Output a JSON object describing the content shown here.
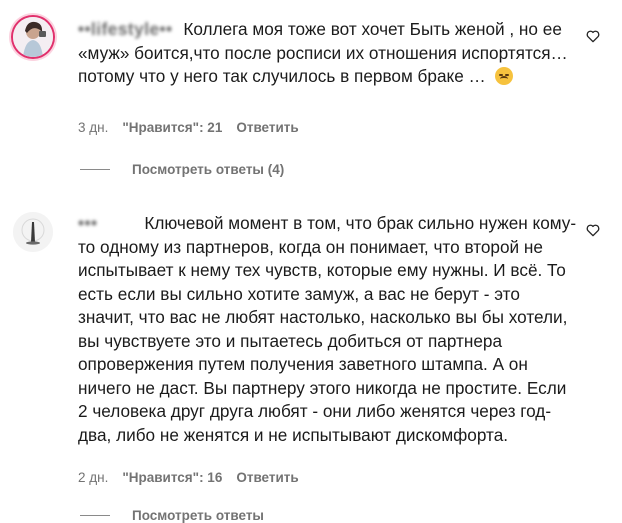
{
  "comments": [
    {
      "author": "••lifestyle••",
      "text": "Коллега моя тоже вот хочет Быть женой , но ее «муж» боится,что после росписи их отношения испортятся… потому что у него так случилось в первом браке …",
      "emoji": "sad-face",
      "time": "3 дн.",
      "likes": "\"Нравится\": 21",
      "reply": "Ответить",
      "view_replies": "Посмотреть ответы (4)"
    },
    {
      "author": "•••",
      "text": "Ключевой момент в том, что брак сильно нужен кому-то одному из партнеров, когда он понимает, что второй не испытывает к нему тех чувств, которые ему нужны. И всё. То есть если вы сильно хотите замуж, а вас не берут - это значит, что вас не любят настолько, насколько вы бы хотели, вы чувствуете это и пытаетесь добиться от партнера опровержения путем получения заветного штампа. А он ничего не даст. Вы партнеру этого никогда не простите. Если 2 человека друг друга любят - они либо женятся через год-два, либо не женятся и не испытывают дискомфорта.",
      "time": "2 дн.",
      "likes": "\"Нравится\": 16",
      "reply": "Ответить"
    }
  ],
  "footer_partial": "Посмотреть ответы"
}
